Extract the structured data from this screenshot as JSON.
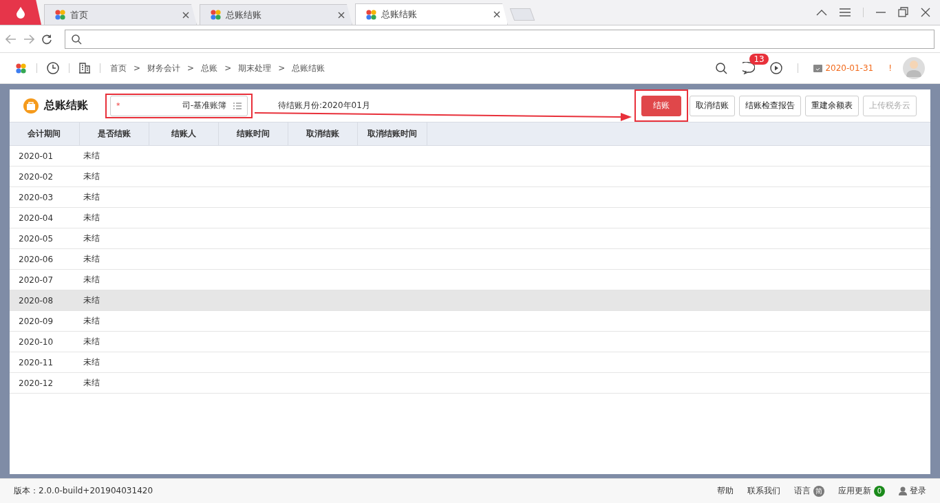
{
  "browser": {
    "tabs": [
      {
        "label": "首页",
        "selected": false
      },
      {
        "label": "总账结账",
        "selected": false
      },
      {
        "label": "总账结账",
        "selected": true
      }
    ]
  },
  "app_header": {
    "breadcrumb": [
      "首页",
      "财务会计",
      "总账",
      "期末处理",
      "总账结账"
    ],
    "separator": ">",
    "message_count": "13",
    "date": "2020-01-31",
    "alert": "!"
  },
  "page": {
    "title": "总账结账",
    "ledger_field": {
      "required_mark": "*",
      "value": "司-基准账簿"
    },
    "pending_month": "待结账月份:2020年01月",
    "buttons": [
      {
        "label": "结账",
        "kind": "primary",
        "disabled": false
      },
      {
        "label": "取消结账",
        "kind": "default",
        "disabled": false
      },
      {
        "label": "结账检查报告",
        "kind": "default",
        "disabled": false
      },
      {
        "label": "重建余额表",
        "kind": "default",
        "disabled": false
      },
      {
        "label": "上传税务云",
        "kind": "default",
        "disabled": true
      }
    ]
  },
  "table": {
    "columns": [
      "会计期间",
      "是否结账",
      "结账人",
      "结账时间",
      "取消结账",
      "取消结账时间"
    ],
    "rows": [
      {
        "cells": [
          "2020-01",
          "未结"
        ],
        "selected": false
      },
      {
        "cells": [
          "2020-02",
          "未结"
        ],
        "selected": false
      },
      {
        "cells": [
          "2020-03",
          "未结"
        ],
        "selected": false
      },
      {
        "cells": [
          "2020-04",
          "未结"
        ],
        "selected": false
      },
      {
        "cells": [
          "2020-05",
          "未结"
        ],
        "selected": false
      },
      {
        "cells": [
          "2020-06",
          "未结"
        ],
        "selected": false
      },
      {
        "cells": [
          "2020-07",
          "未结"
        ],
        "selected": false
      },
      {
        "cells": [
          "2020-08",
          "未结"
        ],
        "selected": true
      },
      {
        "cells": [
          "2020-09",
          "未结"
        ],
        "selected": false
      },
      {
        "cells": [
          "2020-10",
          "未结"
        ],
        "selected": false
      },
      {
        "cells": [
          "2020-11",
          "未结"
        ],
        "selected": false
      },
      {
        "cells": [
          "2020-12",
          "未结"
        ],
        "selected": false
      }
    ]
  },
  "status_bar": {
    "version": "版本：2.0.0-build+201904031420",
    "links": [
      {
        "label": "帮助",
        "kind": "text"
      },
      {
        "label": "联系我们",
        "kind": "text"
      },
      {
        "label": "语言",
        "kind": "badge",
        "badge": "简",
        "color": "#7a7a7a"
      },
      {
        "label": "应用更新",
        "kind": "badge",
        "badge": "0",
        "color": "#1a8a1a"
      },
      {
        "label": "登录",
        "kind": "user"
      }
    ]
  }
}
